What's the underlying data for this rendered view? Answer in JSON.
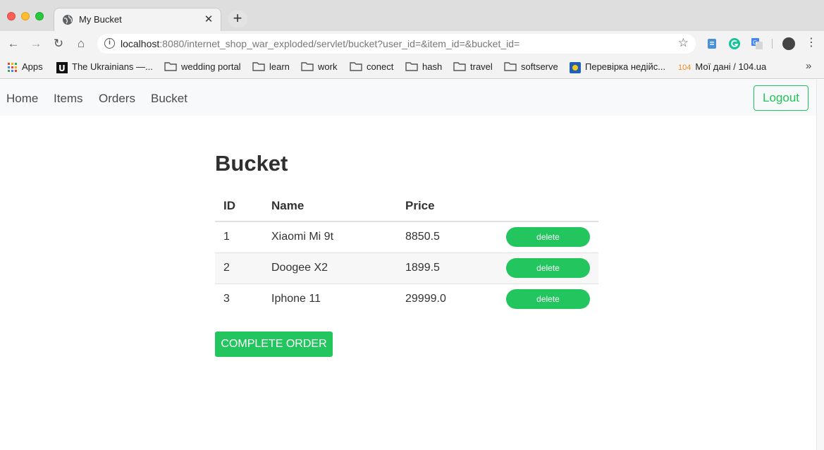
{
  "browser": {
    "tab_title": "My Bucket",
    "url_host": "localhost",
    "url_rest": ":8080/internet_shop_war_exploded/servlet/bucket?user_id=&item_id=&bucket_id=",
    "bookmarks": [
      "Apps",
      "The Ukrainians —...",
      "wedding portal",
      "learn",
      "work",
      "conect",
      "hash",
      "travel",
      "softserve",
      "Перевірка недійс...",
      "Мої дані / 104.ua"
    ],
    "bookmark_104_badge": "104"
  },
  "nav": {
    "links": [
      "Home",
      "Items",
      "Orders",
      "Bucket"
    ],
    "logout_label": "Logout"
  },
  "page": {
    "title": "Bucket",
    "complete_label": "COMPLETE ORDER"
  },
  "table": {
    "headers": [
      "ID",
      "Name",
      "Price"
    ],
    "rows": [
      {
        "id": "1",
        "name": "Xiaomi Mi 9t",
        "price": "8850.5",
        "action": "delete"
      },
      {
        "id": "2",
        "name": "Doogee X2",
        "price": "1899.5",
        "action": "delete"
      },
      {
        "id": "3",
        "name": "Iphone 11",
        "price": "29999.0",
        "action": "delete"
      }
    ]
  },
  "colors": {
    "accent_green": "#22c55e",
    "nav_background": "#f8f9fa"
  }
}
